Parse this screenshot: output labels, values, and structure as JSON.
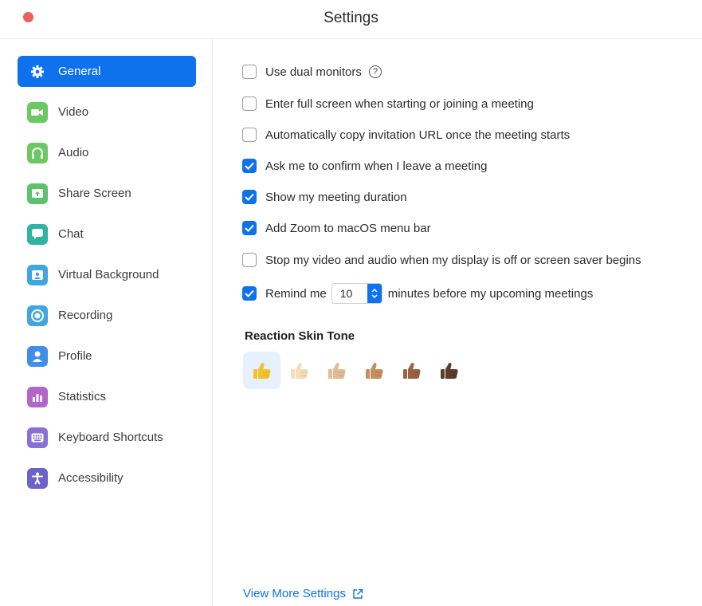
{
  "window": {
    "title": "Settings"
  },
  "sidebar": {
    "items": [
      {
        "label": "General",
        "icon": "gear-icon",
        "color": "#0e72ed"
      },
      {
        "label": "Video",
        "icon": "video-icon",
        "color": "#6cc860"
      },
      {
        "label": "Audio",
        "icon": "headphones-icon",
        "color": "#6cc860"
      },
      {
        "label": "Share Screen",
        "icon": "share-screen-icon",
        "color": "#5cc26e"
      },
      {
        "label": "Chat",
        "icon": "chat-icon",
        "color": "#30b3a0"
      },
      {
        "label": "Virtual Background",
        "icon": "virtual-background-icon",
        "color": "#3fa6e0"
      },
      {
        "label": "Recording",
        "icon": "recording-icon",
        "color": "#3fa6e0"
      },
      {
        "label": "Profile",
        "icon": "profile-icon",
        "color": "#3d8fe8"
      },
      {
        "label": "Statistics",
        "icon": "statistics-icon",
        "color": "#b266c9"
      },
      {
        "label": "Keyboard Shortcuts",
        "icon": "keyboard-icon",
        "color": "#8a6fd6"
      },
      {
        "label": "Accessibility",
        "icon": "accessibility-icon",
        "color": "#6c63c9"
      }
    ]
  },
  "options": [
    {
      "label": "Use dual monitors",
      "checked": false,
      "help": "?"
    },
    {
      "label": "Enter full screen when starting or joining a meeting",
      "checked": false
    },
    {
      "label": "Automatically copy invitation URL once the meeting starts",
      "checked": false
    },
    {
      "label": "Ask me to confirm when I leave a meeting",
      "checked": true
    },
    {
      "label": "Show my meeting duration",
      "checked": true
    },
    {
      "label": "Add Zoom to macOS menu bar",
      "checked": true
    },
    {
      "label": "Stop my video and audio when my display is off or screen saver begins",
      "checked": false
    }
  ],
  "reminder": {
    "checked": true,
    "prefix": "Remind me",
    "value": "10",
    "suffix": "minutes before my upcoming meetings"
  },
  "reaction": {
    "title": "Reaction Skin Tone",
    "selected_index": 0,
    "tones": [
      "#f4c22b",
      "#f7dcb8",
      "#e3bb93",
      "#c78e5e",
      "#9a6240",
      "#5b3b2a"
    ]
  },
  "footer": {
    "view_more": "View More Settings",
    "icon": "external-link-icon"
  },
  "colors": {
    "accent": "#0e72ed",
    "close": "#ec5f58"
  }
}
